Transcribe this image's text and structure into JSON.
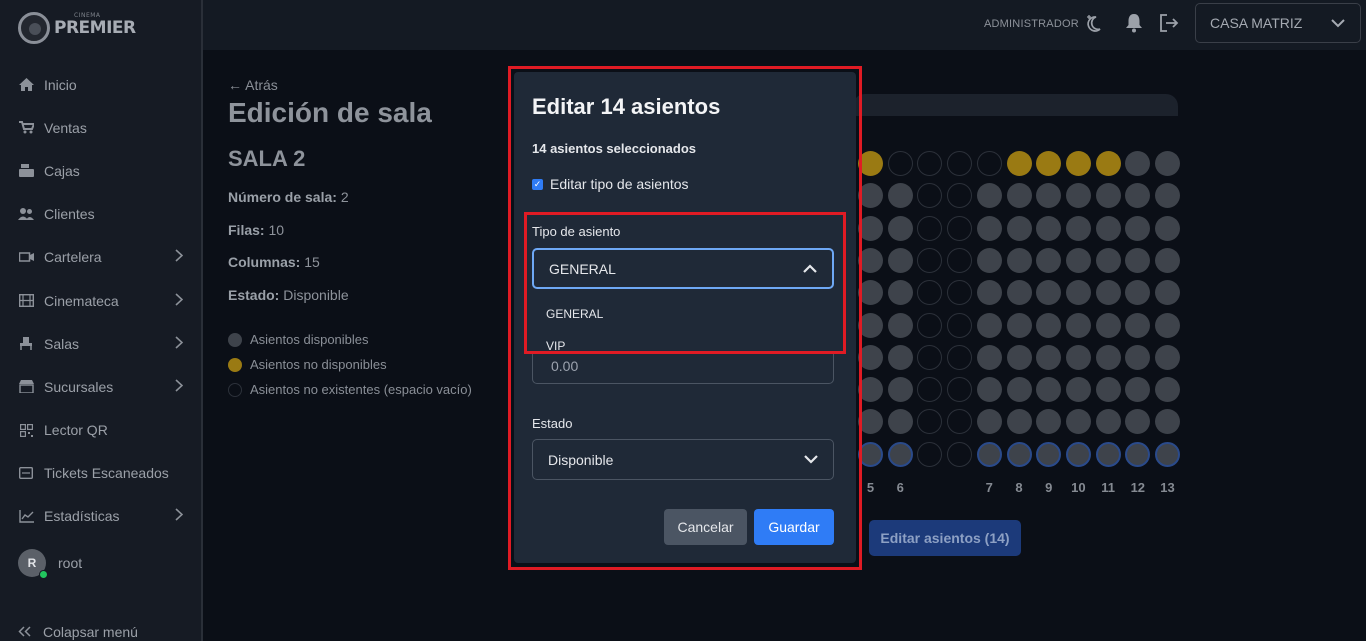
{
  "brand": {
    "name": "PREMIER",
    "tagline": "CINEMA"
  },
  "sidebar": {
    "items": [
      {
        "label": "Inicio",
        "icon": "home-icon",
        "chevron": false
      },
      {
        "label": "Ventas",
        "icon": "cart-icon",
        "chevron": false
      },
      {
        "label": "Cajas",
        "icon": "cash-register-icon",
        "chevron": false
      },
      {
        "label": "Clientes",
        "icon": "users-icon",
        "chevron": false
      },
      {
        "label": "Cartelera",
        "icon": "film-icon",
        "chevron": true
      },
      {
        "label": "Cinemateca",
        "icon": "film-strip-icon",
        "chevron": true
      },
      {
        "label": "Salas",
        "icon": "seat-icon",
        "chevron": true
      },
      {
        "label": "Sucursales",
        "icon": "store-icon",
        "chevron": true
      },
      {
        "label": "Lector QR",
        "icon": "qr-icon",
        "chevron": false
      },
      {
        "label": "Tickets Escaneados",
        "icon": "ticket-icon",
        "chevron": false
      },
      {
        "label": "Estadísticas",
        "icon": "chart-icon",
        "chevron": true
      }
    ],
    "user": {
      "initial": "R",
      "name": "root"
    },
    "collapse_label": "Colapsar menú"
  },
  "topbar": {
    "role": "ADMINISTRADOR",
    "branch": "CASA MATRIZ"
  },
  "page": {
    "back_label": "Atrás",
    "title": "Edición de sala",
    "room_name": "SALA 2",
    "info": [
      {
        "label": "Número de sala:",
        "value": "2"
      },
      {
        "label": "Filas:",
        "value": "10"
      },
      {
        "label": "Columnas:",
        "value": "15"
      },
      {
        "label": "Estado:",
        "value": "Disponible"
      }
    ],
    "legend": [
      {
        "label": "Asientos disponibles",
        "color": "#3e434b"
      },
      {
        "label": "Asientos no disponibles",
        "color": "#9a7a13"
      },
      {
        "label": "Asientos no existentes (espacio vacío)",
        "color": "transparent"
      }
    ],
    "column_numbers": [
      "5",
      "6",
      "7",
      "8",
      "9",
      "10",
      "11",
      "12",
      "13"
    ],
    "edit_button": "Editar asientos (14)"
  },
  "modal": {
    "title": "Editar 14 asientos",
    "selected_count": "14 asientos seleccionados",
    "edit_type_label": "Editar tipo de asientos",
    "edit_type_checked": true,
    "seat_type_label": "Tipo de asiento",
    "seat_type_value": "GENERAL",
    "seat_type_options": [
      "GENERAL",
      "VIP"
    ],
    "price_value": "0.00",
    "status_label": "Estado",
    "status_value": "Disponible",
    "cancel_label": "Cancelar",
    "save_label": "Guardar"
  },
  "colors": {
    "accent": "#2f7cf6",
    "highlight": "#e01b24",
    "unavailable": "#9a7a13"
  }
}
